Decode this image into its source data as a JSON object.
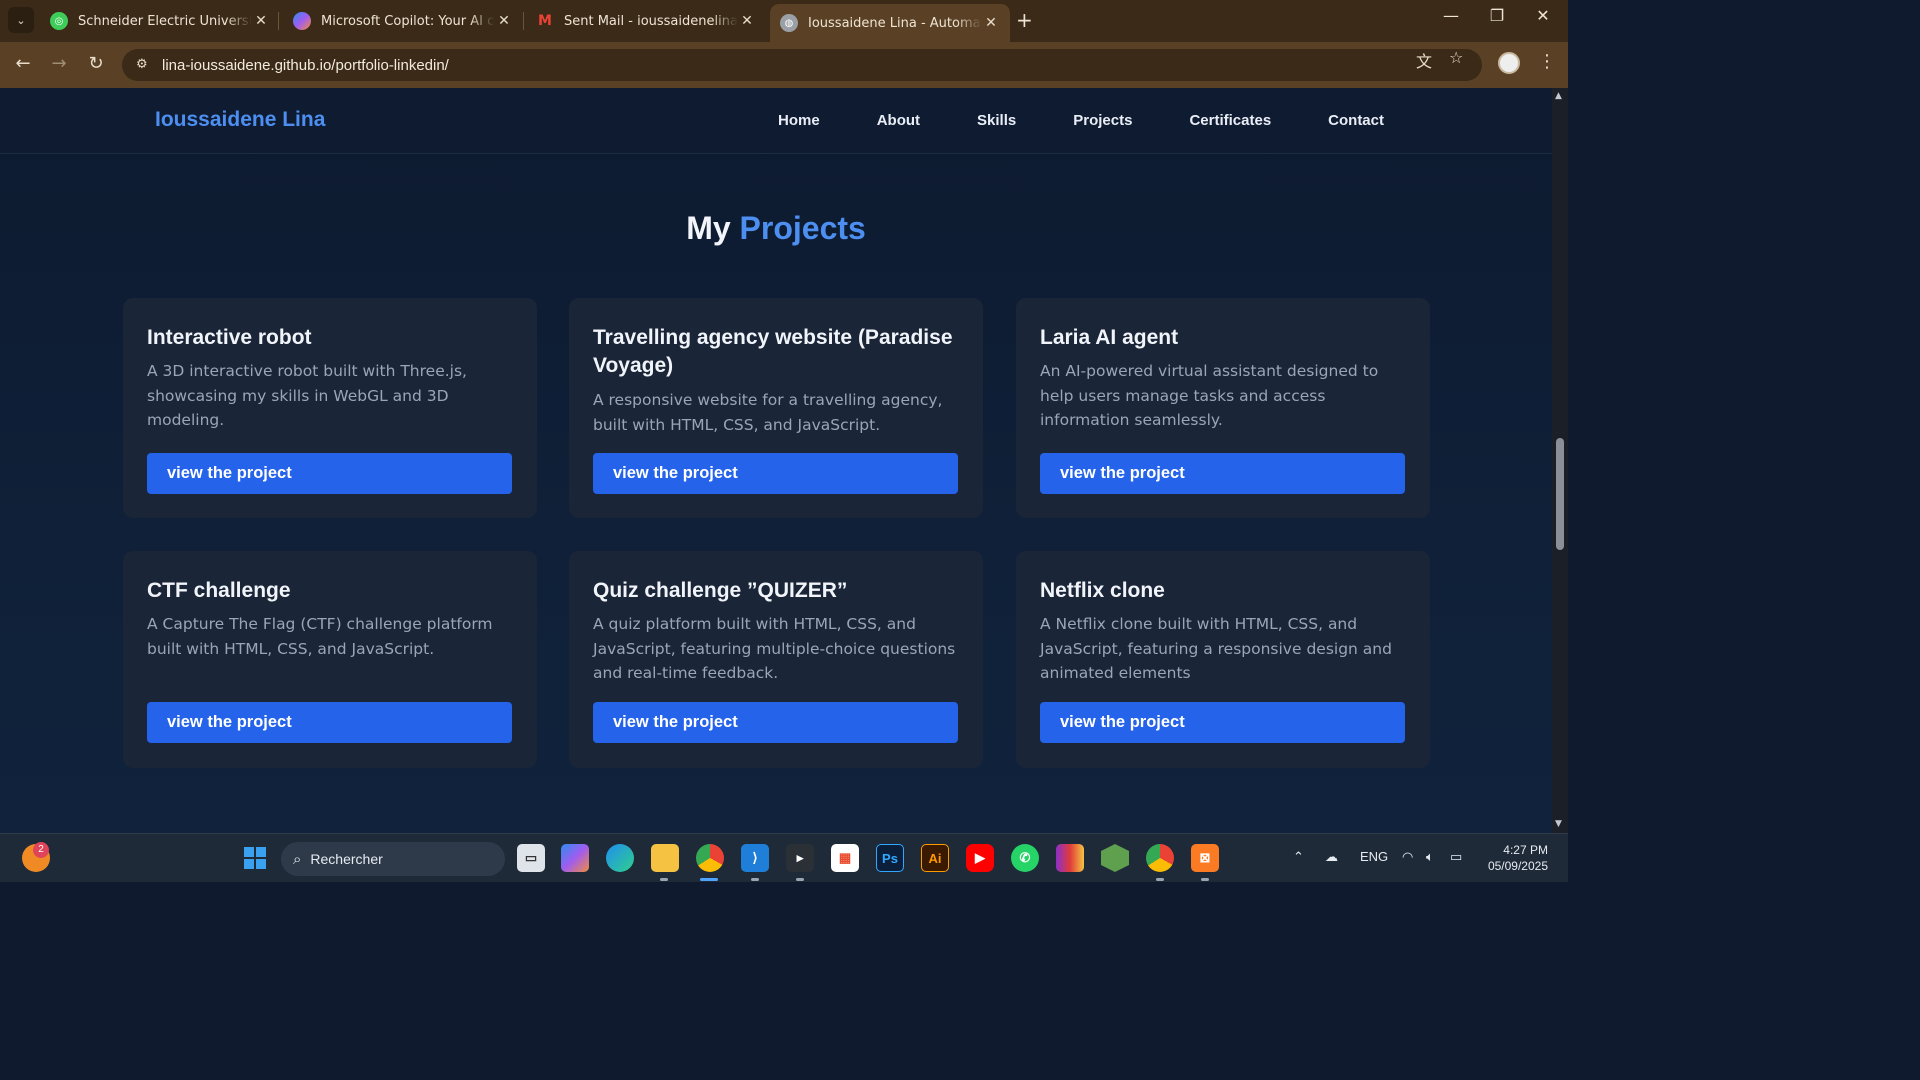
{
  "browser": {
    "tabs": [
      {
        "title": "Schneider Electric University | b",
        "icon": "schneider-favicon",
        "color": "#3dcd58"
      },
      {
        "title": "Microsoft Copilot: Your AI comp",
        "icon": "copilot-favicon",
        "color": "#7b5cf0"
      },
      {
        "title": "Sent Mail - ioussaidenelina@gm",
        "icon": "gmail-favicon",
        "color": "#ea4335"
      },
      {
        "title": "Ioussaidene Lina - Automation E",
        "icon": "globe-favicon",
        "color": "#9aa0a6"
      }
    ],
    "url": "lina-ioussaidene.github.io/portfolio-linkedin/"
  },
  "site": {
    "brand": "Ioussaidene Lina",
    "nav": [
      "Home",
      "About",
      "Skills",
      "Projects",
      "Certificates",
      "Contact"
    ],
    "section_title_prefix": "My",
    "section_title_accent": "Projects",
    "accent_color": "#4d8ff0",
    "button_color": "#2563eb",
    "projects": [
      {
        "title": "Interactive robot",
        "description": "A 3D interactive robot built with Three.js, showcasing my skills in WebGL and 3D modeling.",
        "button": "view the project"
      },
      {
        "title": "Travelling agency website (Paradise Voyage)",
        "description": "A responsive website for a travelling agency, built with HTML, CSS, and JavaScript.",
        "button": "view the project"
      },
      {
        "title": "Laria AI agent",
        "description": "An AI-powered virtual assistant designed to help users manage tasks and access information seamlessly.",
        "button": "view the project"
      },
      {
        "title": "CTF challenge",
        "description": "A Capture The Flag (CTF) challenge platform built with HTML, CSS, and JavaScript.",
        "button": "view the project"
      },
      {
        "title": "Quiz challenge ”QUIZER”",
        "description": "A quiz platform built with HTML, CSS, and JavaScript, featuring multiple-choice questions and real-time feedback.",
        "button": "view the project"
      },
      {
        "title": "Netflix clone",
        "description": "A Netflix clone built with HTML, CSS, and JavaScript, featuring a responsive design and animated elements",
        "button": "view the project"
      }
    ]
  },
  "taskbar": {
    "search_placeholder": "Rechercher",
    "notification_count": "2",
    "language": "ENG",
    "time": "4:27 PM",
    "date": "05/09/2025",
    "apps": [
      "start-icon",
      "task-view-icon",
      "copilot-icon",
      "edge-icon",
      "file-explorer-icon",
      "chrome-icon",
      "vscode-icon",
      "terminal-icon",
      "store-icon",
      "photoshop-icon",
      "illustrator-icon",
      "youtube-icon",
      "whatsapp-icon",
      "winrar-icon",
      "nodejs-icon",
      "chrome-alt-icon",
      "xampp-icon"
    ]
  }
}
